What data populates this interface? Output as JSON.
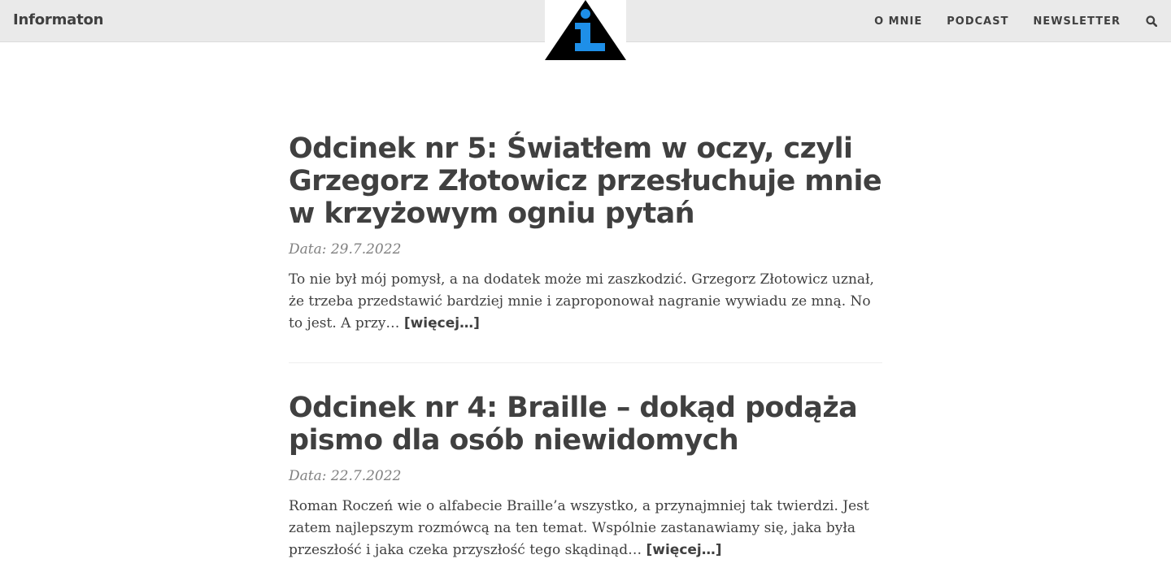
{
  "navbar": {
    "brand": "Informaton",
    "links": [
      {
        "label": "O MNIE"
      },
      {
        "label": "PODCAST"
      },
      {
        "label": "NEWSLETTER"
      }
    ],
    "search_icon": "search-icon",
    "logo": {
      "icon": "info-triangle-logo",
      "letter": "i",
      "accent_color": "#1e8fe8"
    }
  },
  "posts": [
    {
      "title": "Odcinek nr 5: Światłem w oczy, czyli Grzegorz Złotowicz przesłuchuje mnie w krzyżowym ogniu pytań",
      "meta": "Data: 29.7.2022",
      "excerpt": "To nie był mój pomysł, a na dodatek może mi zaszkodzić. Grzegorz Złotowicz uznał, że trzeba przedstawić bardziej mnie i zaproponował nagranie wywiadu ze mną. No to jest. A przy…",
      "more": "[więcej…]"
    },
    {
      "title": "Odcinek nr 4: Braille – dokąd podąża pismo dla osób niewidomych",
      "meta": "Data: 22.7.2022",
      "excerpt": "Roman Roczeń wie o alfabecie Braille’a wszystko, a przynajmniej tak twierdzi. Jest zatem najlepszym rozmówcą na ten temat. Wspólnie zastanawiamy się, jaka była przeszłość i jaka czeka przyszłość tego skądinąd…",
      "more": "[więcej…]"
    }
  ],
  "colors": {
    "navbar_bg": "#eaeaea",
    "text": "#404040",
    "meta": "#808080",
    "logo_accent": "#1e8fe8"
  }
}
